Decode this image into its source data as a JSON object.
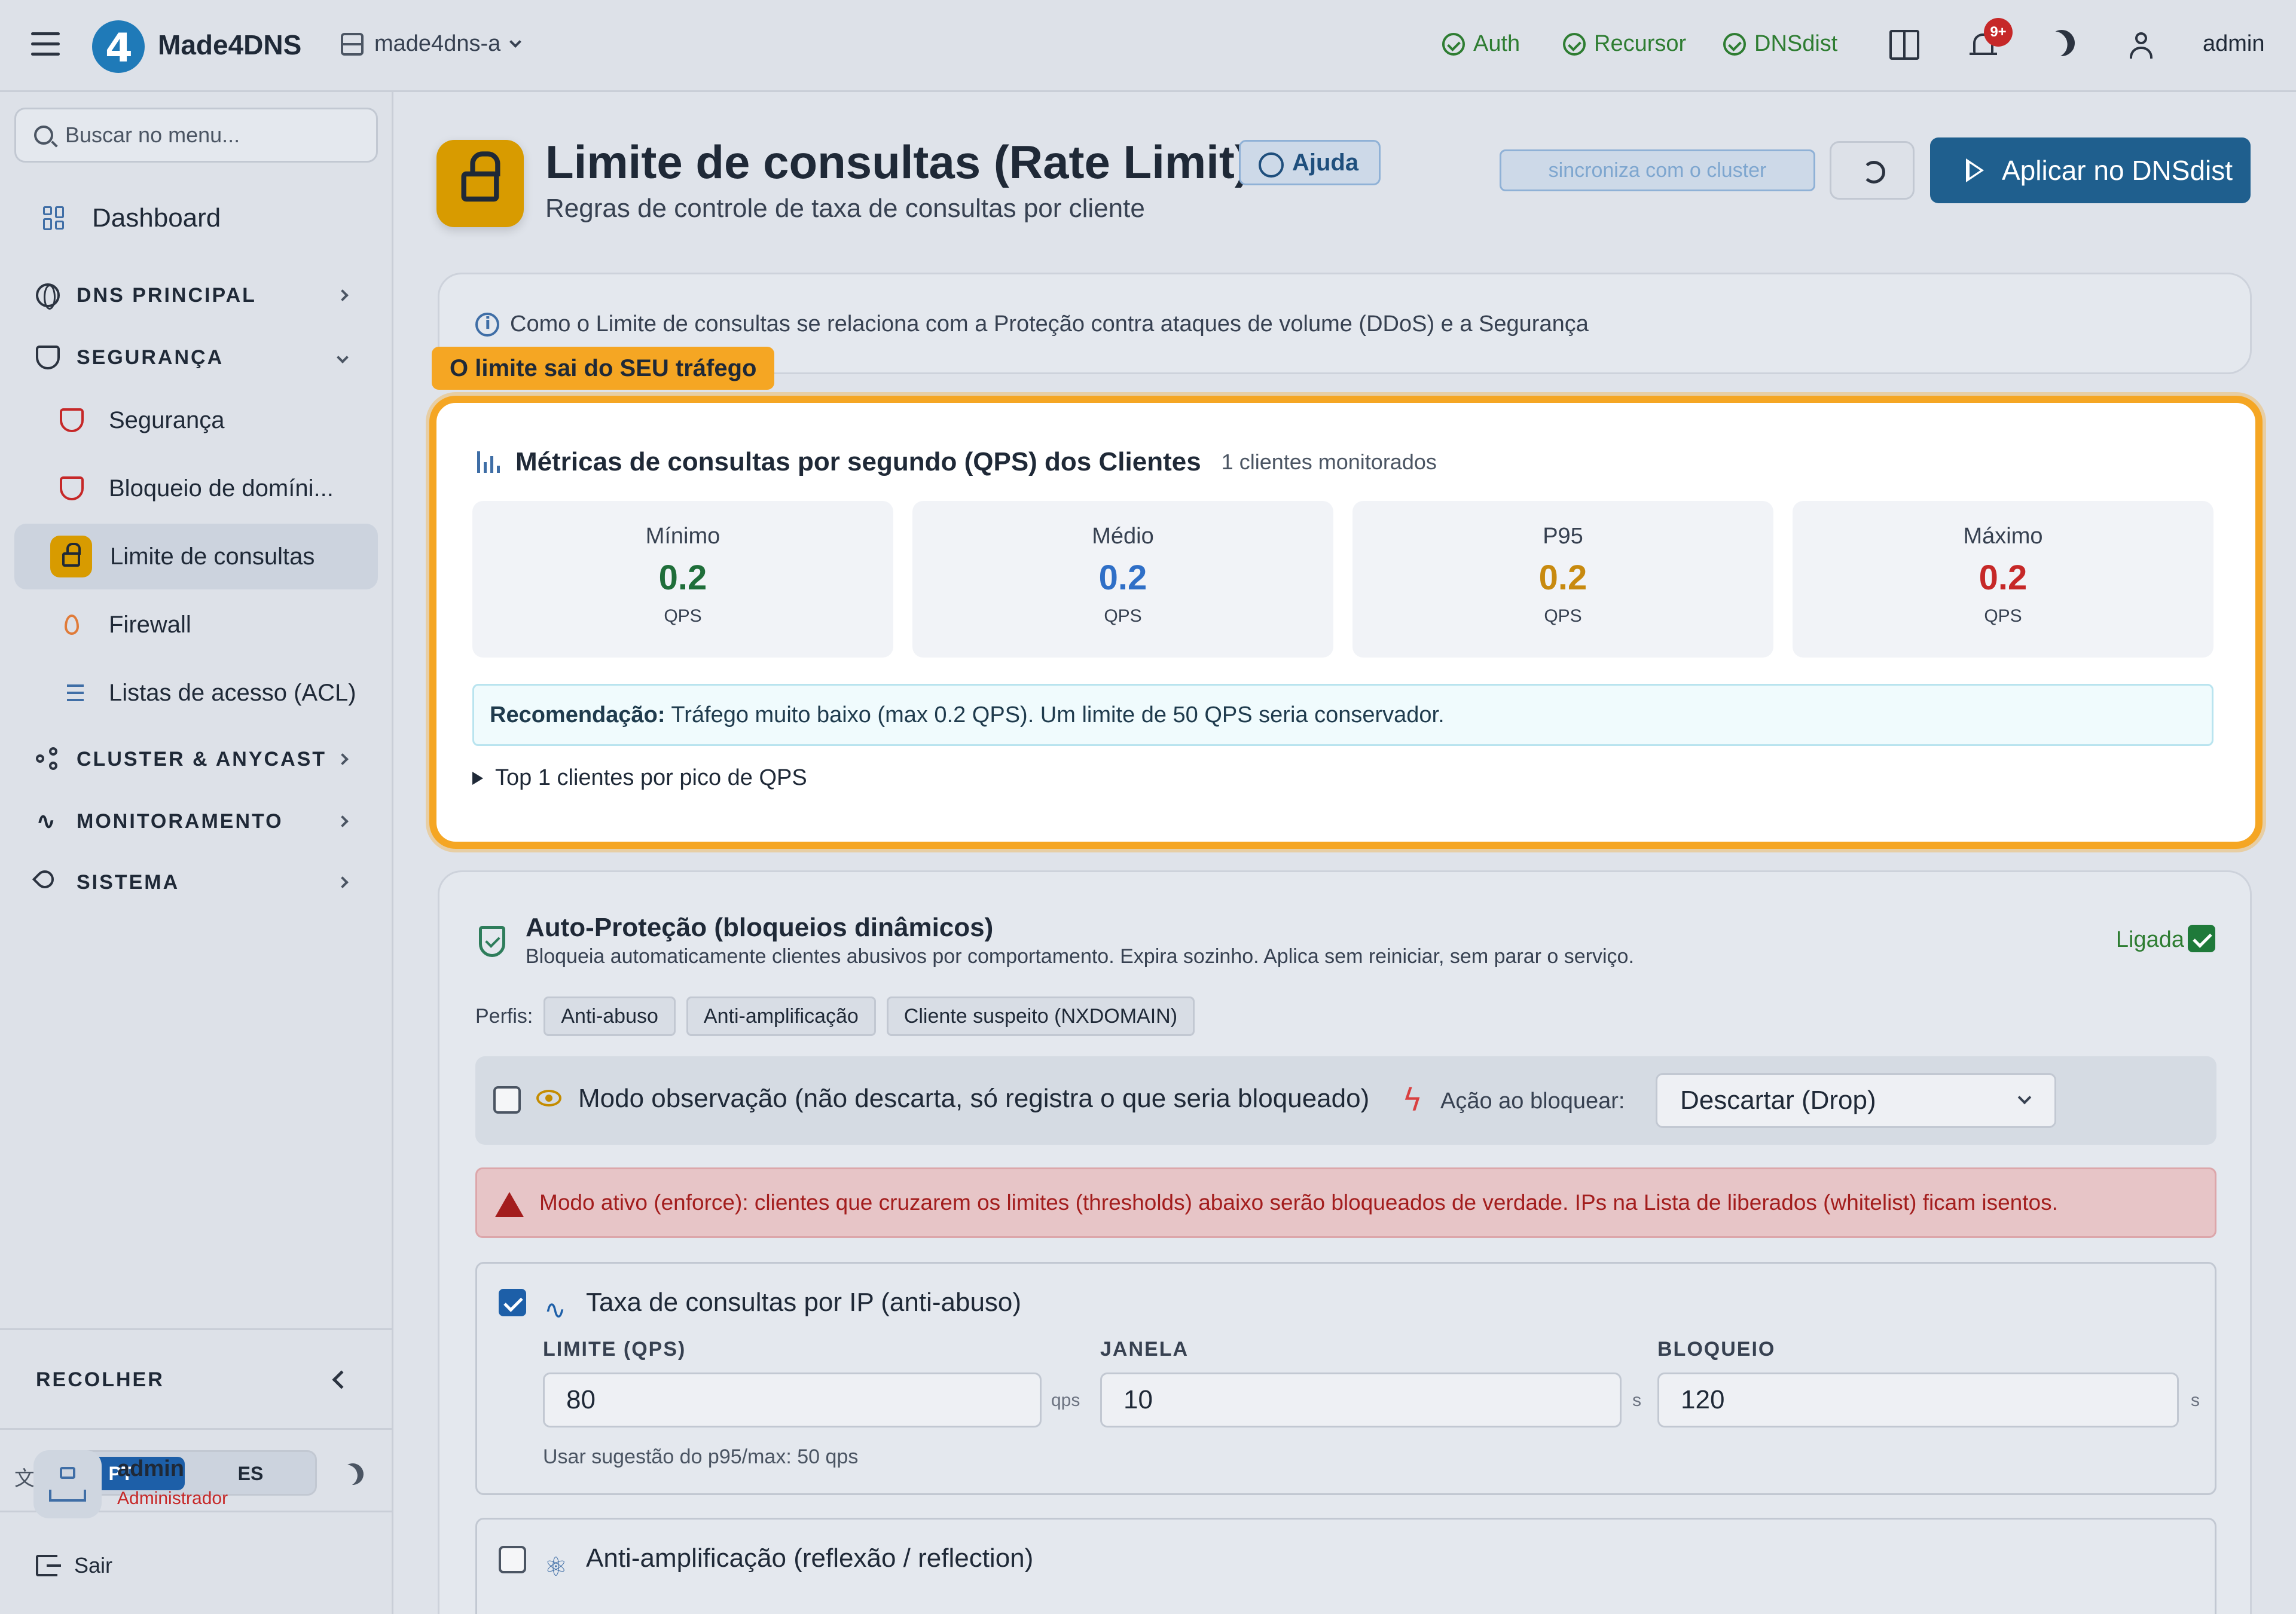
{
  "header": {
    "brand": "Made4DNS",
    "server": "made4dns-a",
    "status": [
      "Auth",
      "Recursor",
      "DNSdist"
    ],
    "notifications_badge": "9+",
    "user": "admin"
  },
  "sidebar": {
    "search_placeholder": "Buscar no menu...",
    "dashboard": "Dashboard",
    "sections": {
      "dns": "DNS PRINCIPAL",
      "security": "SEGURANÇA",
      "cluster": "CLUSTER & ANYCAST",
      "monitoring": "MONITORAMENTO",
      "system": "SISTEMA"
    },
    "security_items": [
      "Segurança",
      "Bloqueio de domíni...",
      "Limite de consultas",
      "Firewall",
      "Listas de acesso (ACL)"
    ],
    "collapse": "RECOLHER",
    "lang": {
      "pt": "PT",
      "es": "ES"
    },
    "user": {
      "name": "admin",
      "role": "Administrador"
    },
    "logout": "Sair"
  },
  "page": {
    "title": "Limite de consultas (Rate Limit)",
    "help": "Ajuda",
    "subtitle": "Regras de controle de taxa de consultas por cliente",
    "sync": "sincroniza com o cluster",
    "apply": "Aplicar no DNSdist"
  },
  "info": {
    "text": "Como o Limite de consultas se relaciona com a Proteção contra ataques de volume (DDoS) e a Segurança"
  },
  "callout": "O limite sai do SEU tráfego",
  "metrics": {
    "title": "Métricas de consultas por segundo (QPS) dos Clientes",
    "count": "1 clientes monitorados",
    "stats": [
      {
        "label": "Mínimo",
        "value": "0.2",
        "unit": "QPS",
        "color": "#1f6e3a"
      },
      {
        "label": "Médio",
        "value": "0.2",
        "unit": "QPS",
        "color": "#2f6fc7"
      },
      {
        "label": "P95",
        "value": "0.2",
        "unit": "QPS",
        "color": "#c88a0f"
      },
      {
        "label": "Máximo",
        "value": "0.2",
        "unit": "QPS",
        "color": "#c62828"
      }
    ],
    "recommendation_label": "Recomendação:",
    "recommendation": "Tráfego muito baixo (max 0.2 QPS). Um limite de 50 QPS seria conservador.",
    "top_clients": "Top 1 clientes por pico de QPS"
  },
  "autoprot": {
    "title": "Auto-Proteção (bloqueios dinâmicos)",
    "desc": "Bloqueia automaticamente clientes abusivos por comportamento. Expira sozinho. Aplica sem reiniciar, sem parar o serviço.",
    "status": "Ligada",
    "profiles_label": "Perfis:",
    "profiles": [
      "Anti-abuso",
      "Anti-amplificação",
      "Cliente suspeito (NXDOMAIN)"
    ],
    "observe": "Modo observação (não descarta, só registra o que seria bloqueado)",
    "action_label": "Ação ao bloquear:",
    "action_value": "Descartar (Drop)",
    "warning": "Modo ativo (enforce): clientes que cruzarem os limites (thresholds) abaixo serão bloqueados de verdade. IPs na Lista de liberados (whitelist) ficam isentos.",
    "rule1": {
      "title": "Taxa de consultas por IP (anti-abuso)",
      "limit_label": "LIMITE (QPS)",
      "limit": "80",
      "limit_unit": "qps",
      "window_label": "JANELA",
      "window": "10",
      "window_unit": "s",
      "block_label": "BLOQUEIO",
      "block": "120",
      "block_unit": "s",
      "hint": "Usar sugestão do p95/max: 50 qps"
    },
    "rule2": {
      "title": "Anti-amplificação (reflexão / reflection)"
    }
  }
}
